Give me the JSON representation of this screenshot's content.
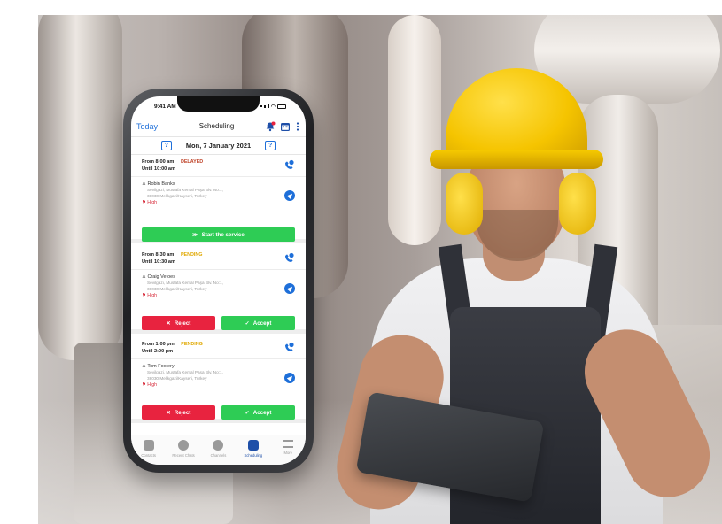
{
  "status_bar": {
    "time": "9:41 AM"
  },
  "navbar": {
    "today": "Today",
    "title": "Scheduling"
  },
  "date_bar": {
    "prev": "?",
    "date": "Mon, 7 January 2021",
    "next": "?"
  },
  "appointments": [
    {
      "from": "From 8:00 am",
      "until": "Until 10:00 am",
      "status": "DELAYED",
      "customer": "Robin Banks",
      "address_1": "Sevilgazi, Mustafa Kemal Paşa Blv. No:1,",
      "address_2": "38030 Melikgazi/Kayseri, Turkey",
      "priority": "High",
      "action": "Start the service"
    },
    {
      "from": "From 8:30 am",
      "until": "Until 10:30 am",
      "status": "PENDING",
      "customer": "Craig Vetoes",
      "address_1": "Sevilgazi, Mustafa Kemal Paşa Blv. No:1,",
      "address_2": "38030 Melikgazi/Kayseri, Turkey",
      "priority": "High",
      "reject": "Reject",
      "accept": "Accept"
    },
    {
      "from": "From 1:00 pm",
      "until": "Until 2:00 pm",
      "status": "PENDING",
      "customer": "Tom Foolery",
      "address_1": "Sevilgazi, Mustafa Kemal Paşa Blv. No:1,",
      "address_2": "38030 Melikgazi/Kayseri, Turkey",
      "priority": "High",
      "reject": "Reject",
      "accept": "Accept"
    }
  ],
  "tabs": [
    {
      "label": "Contacts",
      "icon": "contacts-icon",
      "active": false
    },
    {
      "label": "Recent Chats",
      "icon": "chat-icon",
      "active": false
    },
    {
      "label": "Channels",
      "icon": "channels-icon",
      "active": false
    },
    {
      "label": "Scheduling",
      "icon": "scheduling-icon",
      "active": true
    },
    {
      "label": "More",
      "icon": "menu-icon",
      "active": false
    }
  ],
  "colors": {
    "accent_blue": "#1e6fd9",
    "accept_green": "#2ecc55",
    "reject_red": "#e8233f",
    "delayed": "#c0452b",
    "pending": "#e0a800",
    "helmet_yellow": "#f5c400"
  }
}
